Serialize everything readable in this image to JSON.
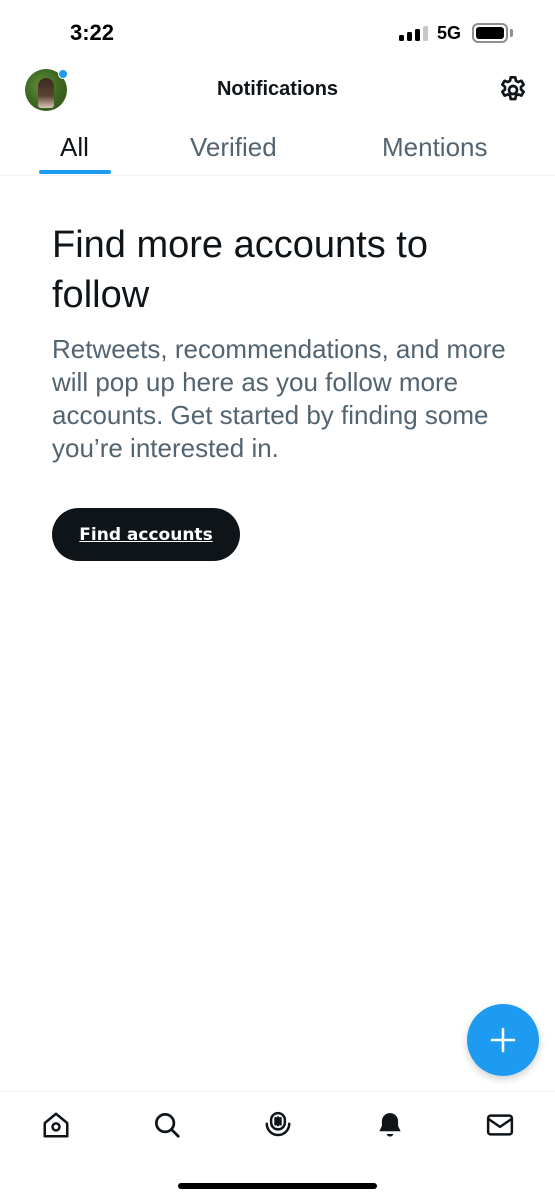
{
  "status_bar": {
    "time": "3:22",
    "network": "5G",
    "signal_bars_active": 3,
    "icons": [
      "signal-icon",
      "battery-icon"
    ]
  },
  "header": {
    "title": "Notifications",
    "avatar_notification_color": "#1d9bf0",
    "icons": [
      "avatar",
      "gear-icon"
    ]
  },
  "tabs": [
    {
      "label": "All",
      "active": true
    },
    {
      "label": "Verified",
      "active": false
    },
    {
      "label": "Mentions",
      "active": false
    }
  ],
  "empty_state": {
    "heading": "Find more accounts to follow",
    "body": "Retweets, recommendations, and more will pop up here as you follow more accounts. Get started by finding some you’re interested in.",
    "button_label": "Find accounts"
  },
  "fab": {
    "icon": "plus-icon"
  },
  "bottom_nav": [
    {
      "name": "home",
      "icon": "home-icon"
    },
    {
      "name": "search",
      "icon": "search-icon"
    },
    {
      "name": "spaces",
      "icon": "spaces-icon"
    },
    {
      "name": "notifications",
      "icon": "bell-icon",
      "active": true
    },
    {
      "name": "messages",
      "icon": "mail-icon"
    }
  ],
  "colors": {
    "accent": "#1d9bf0",
    "text_primary": "#0f1419",
    "text_secondary": "#536471",
    "button_dark": "#0f1419"
  }
}
